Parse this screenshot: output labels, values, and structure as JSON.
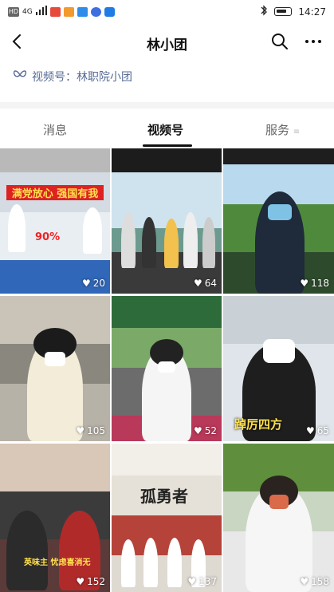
{
  "status": {
    "left_icons": [
      "HD",
      "4G",
      "signal-icon",
      "app-icon-1",
      "app-icon-2",
      "app-icon-3",
      "app-icon-4",
      "app-icon-5"
    ],
    "time": "14:27"
  },
  "nav": {
    "title": "林小团"
  },
  "channel": {
    "label": "视频号：林职院小团"
  },
  "tabs": [
    {
      "label": "消息"
    },
    {
      "label": "视频号"
    },
    {
      "label": "服务"
    }
  ],
  "videos": [
    {
      "likes": "20",
      "caption": "满党放心 强国有我"
    },
    {
      "likes": "64",
      "caption": ""
    },
    {
      "likes": "118",
      "caption": ""
    },
    {
      "likes": "105",
      "caption": ""
    },
    {
      "likes": "52",
      "caption": ""
    },
    {
      "likes": "65",
      "caption": "踔厉四方"
    },
    {
      "likes": "152",
      "caption": "英味主 忧虑喜消无"
    },
    {
      "likes": "137",
      "caption": "孤勇者"
    },
    {
      "likes": "158",
      "caption": ""
    }
  ]
}
